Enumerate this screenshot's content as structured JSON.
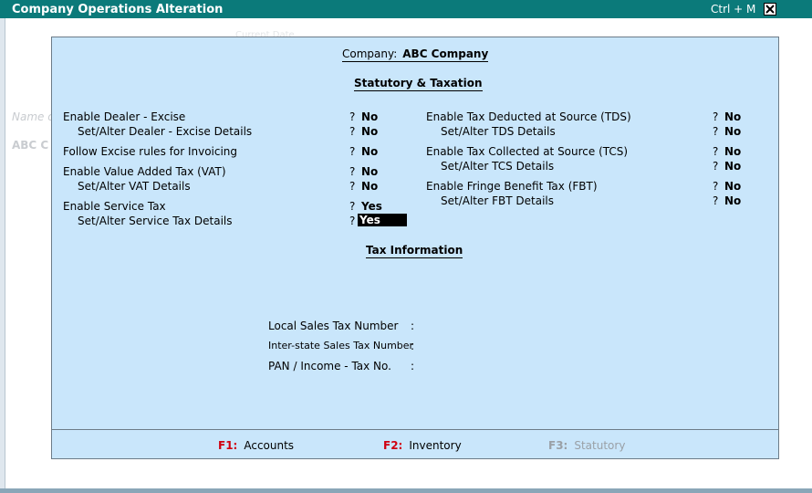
{
  "window": {
    "title": "Company Operations  Alteration",
    "shortcut": "Ctrl + M"
  },
  "background": {
    "ghost_label": "Name o",
    "ghost_company": "ABC C",
    "ghost_top": "Current Date"
  },
  "dialog": {
    "company_label": "Company:",
    "company_name": "ABC Company",
    "section_heading": "Statutory & Taxation",
    "left_options": [
      {
        "label": "Enable Dealer - Excise",
        "q": "?",
        "value": "No"
      },
      {
        "label": "Set/Alter Dealer - Excise Details",
        "q": "?",
        "value": "No"
      },
      {
        "label": "Follow Excise rules for Invoicing",
        "q": "?",
        "value": "No"
      },
      {
        "label": "Enable Value Added Tax (VAT)",
        "q": "?",
        "value": "No"
      },
      {
        "label": "Set/Alter VAT Details",
        "q": "?",
        "value": "No"
      },
      {
        "label": "Enable Service Tax",
        "q": "?",
        "value": "Yes"
      },
      {
        "label": "Set/Alter Service Tax Details",
        "q": "?",
        "value": "Yes"
      }
    ],
    "right_options": [
      {
        "label": "Enable Tax Deducted at Source (TDS)",
        "q": "?",
        "value": "No"
      },
      {
        "label": "Set/Alter TDS Details",
        "q": "?",
        "value": "No"
      },
      {
        "label": "Enable Tax Collected at Source (TCS)",
        "q": "?",
        "value": "No"
      },
      {
        "label": "Set/Alter TCS Details",
        "q": "?",
        "value": "No"
      },
      {
        "label": "Enable Fringe Benefit Tax (FBT)",
        "q": "?",
        "value": "No"
      },
      {
        "label": "Set/Alter FBT Details",
        "q": "?",
        "value": "No"
      }
    ],
    "tax_info_heading": "Tax Information",
    "tax_info": [
      {
        "label": "Local Sales Tax Number",
        "colon": ":",
        "value": ""
      },
      {
        "label": "Inter-state Sales Tax Number",
        "colon": ":",
        "value": ""
      },
      {
        "label": "PAN / Income - Tax No.",
        "colon": ":",
        "value": ""
      }
    ],
    "footer": [
      {
        "key": "F1:",
        "label": "Accounts",
        "enabled": true
      },
      {
        "key": "F2:",
        "label": "Inventory",
        "enabled": true
      },
      {
        "key": "F3:",
        "label": "Statutory",
        "enabled": false
      }
    ]
  },
  "colors": {
    "titlebar": "#0b7a7a",
    "dialog_bg": "#c9e6fb",
    "fkey": "#d00010"
  }
}
